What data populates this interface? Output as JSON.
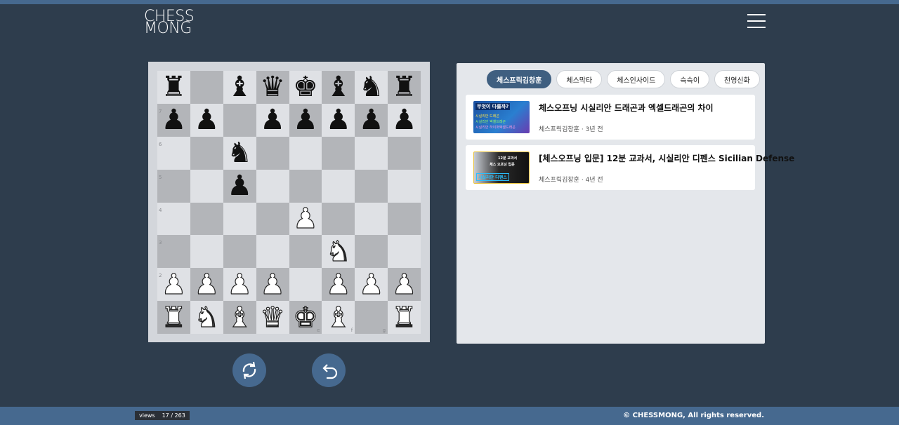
{
  "logo": {
    "line1": "CHESS",
    "line2": "MONG"
  },
  "menu": {
    "icon": "hamburger-menu-icon"
  },
  "board": {
    "colors": {
      "light": "#dfe1e5",
      "dark": "#b3b5b9"
    },
    "pieces": [
      [
        "r",
        "",
        "b",
        "q",
        "k",
        "b",
        "n",
        "r"
      ],
      [
        "p",
        "p",
        "",
        "p",
        "p",
        "p",
        "p",
        "p"
      ],
      [
        "",
        "",
        "n",
        "",
        "",
        "",
        "",
        ""
      ],
      [
        "",
        "",
        "p",
        "",
        "",
        "",
        "",
        ""
      ],
      [
        "",
        "",
        "",
        "",
        "P",
        "",
        "",
        ""
      ],
      [
        "",
        "",
        "",
        "",
        "",
        "N",
        "",
        ""
      ],
      [
        "P",
        "P",
        "P",
        "P",
        "",
        "P",
        "P",
        "P"
      ],
      [
        "R",
        "N",
        "B",
        "Q",
        "K",
        "B",
        "",
        "R"
      ]
    ],
    "ranks": [
      "",
      "7",
      "6",
      "5",
      "4",
      "3",
      "2",
      ""
    ],
    "files_shown": [
      "",
      "",
      "",
      "",
      "e",
      "f",
      "g",
      ""
    ]
  },
  "controls": {
    "flip_icon": "flip-board-icon",
    "undo_icon": "undo-icon"
  },
  "panel": {
    "tabs": [
      {
        "label": "체스프릭김창훈",
        "active": true
      },
      {
        "label": "체스막타",
        "active": false
      },
      {
        "label": "체스인사이드",
        "active": false
      },
      {
        "label": "슥슥이",
        "active": false
      },
      {
        "label": "천영신화",
        "active": false
      }
    ],
    "videos": [
      {
        "title": "체스오프닝 시실리안 드래곤과 엑셀드래곤의 차이",
        "channel": "체스프릭김창훈",
        "age": "3년 전",
        "thumb_texts": [
          "무엇이 다를까?",
          "시실리안 드래곤",
          "시실리안 엑셀드래곤",
          "시실리안 하이퍼엑셀드래곤"
        ]
      },
      {
        "title": "[체스오프닝 입문] 12분 교과서, 시실리안 디펜스 Sicilian Defense",
        "channel": "체스프릭김창훈",
        "age": "4년 전",
        "thumb_texts": [
          "12분 교과서",
          "체스 오프닝 입문",
          "시실리안 디펜스"
        ]
      }
    ]
  },
  "footer": {
    "views_label": "views",
    "views_value": "17 / 263",
    "copyright": "© CHESSMONG, All rights reserved."
  }
}
